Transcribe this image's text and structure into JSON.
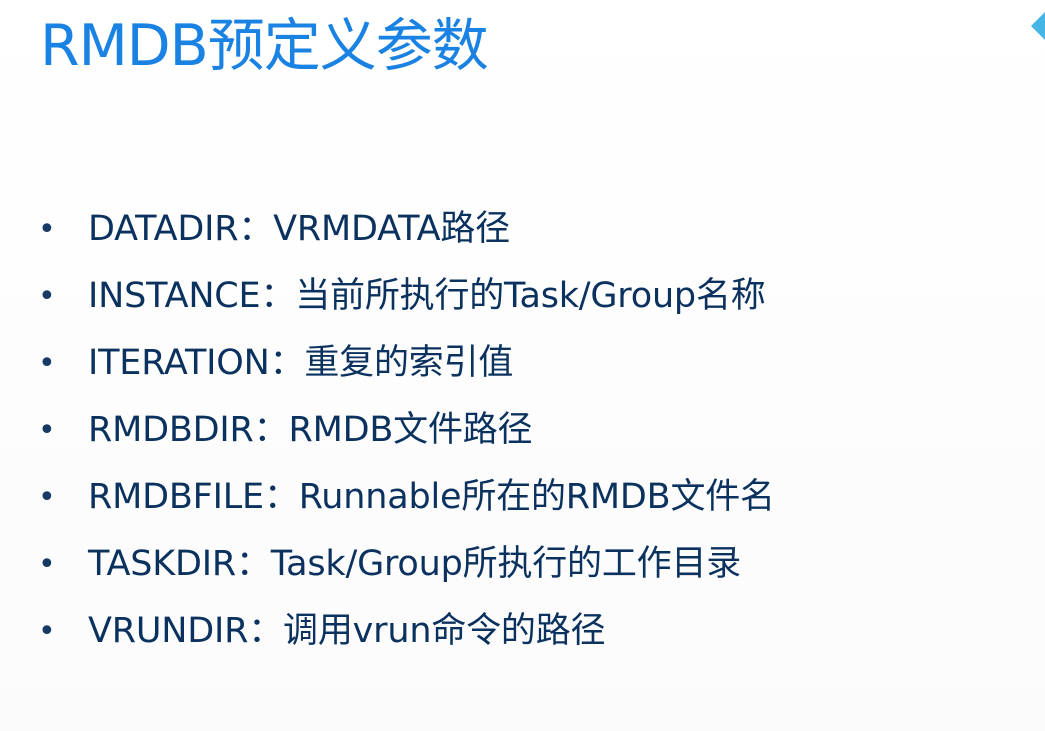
{
  "slide": {
    "title": "RMDB预定义参数",
    "accent_color": "#1a82e2",
    "text_color": "#0b325f",
    "bullets": [
      {
        "text": "DATADIR：VRMDATA路径"
      },
      {
        "text": "INSTANCE：当前所执行的Task/Group名称"
      },
      {
        "text": "ITERATION：重复的索引值"
      },
      {
        "text": "RMDBDIR：RMDB文件路径"
      },
      {
        "text": "RMDBFILE：Runnable所在的RMDB文件名"
      },
      {
        "text": "TASKDIR：Task/Group所执行的工作目录"
      },
      {
        "text": "VRUNDIR：调用vrun命令的路径"
      }
    ],
    "bullet_glyph": "•",
    "corner_icon": "slide-corner-arrow-icon"
  }
}
